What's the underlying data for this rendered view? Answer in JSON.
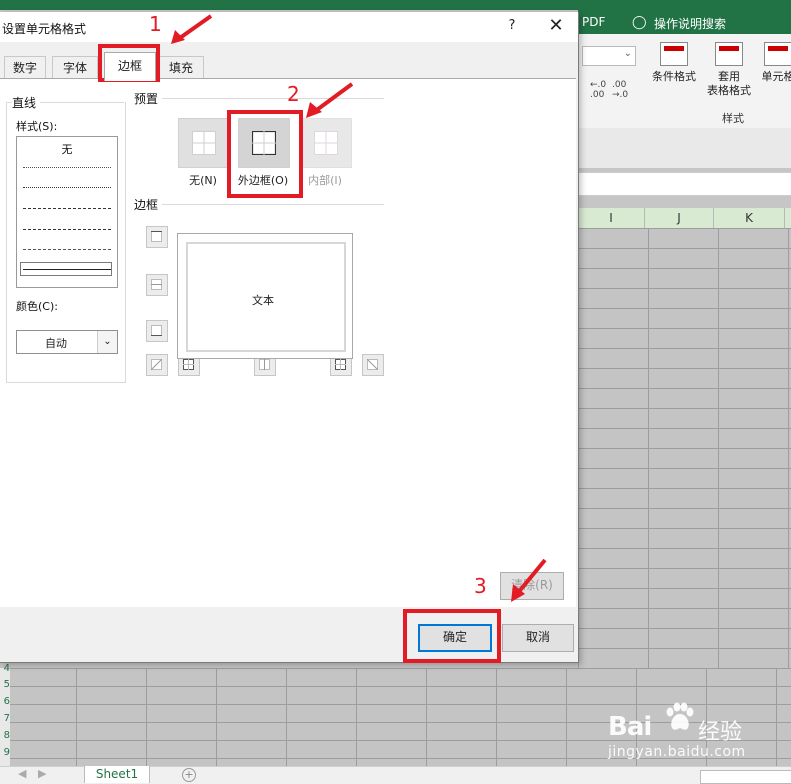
{
  "excel": {
    "ribbon_pdf": "PDF",
    "ribbon_search": "操作说明搜索",
    "conditional_format": "条件格式",
    "table_format_line1": "套用",
    "table_format_line2": "表格格式",
    "cell_styles": "单元格",
    "styles_group": "样式",
    "columns": [
      "I",
      "J",
      "K"
    ],
    "row_numbers": [
      "4",
      "5",
      "6",
      "7",
      "8",
      "9"
    ],
    "sheet_tab": "Sheet1",
    "add_sheet": "+"
  },
  "dialog": {
    "title": "设置单元格格式",
    "help": "?",
    "close": "✕",
    "tabs": [
      {
        "label": "数字",
        "active": false
      },
      {
        "label": "字体",
        "active": false
      },
      {
        "label": "边框",
        "active": true
      },
      {
        "label": "填充",
        "active": false
      }
    ],
    "line_group": {
      "title": "直线",
      "style_label": "样式(S):",
      "style_none": "无",
      "color_label": "颜色(C):",
      "color_value": "自动"
    },
    "presets": {
      "title": "预置",
      "items": [
        {
          "label": "无(N)",
          "enabled": true
        },
        {
          "label": "外边框(O)",
          "enabled": true
        },
        {
          "label": "内部(I)",
          "enabled": false
        }
      ]
    },
    "border": {
      "title": "边框",
      "preview_text": "文本"
    },
    "clear_button": "清除(R)",
    "ok_button": "确定",
    "cancel_button": "取消"
  },
  "annotations": {
    "step1": "1",
    "step2": "2",
    "step3": "3",
    "color": "#e21b25"
  },
  "watermark": {
    "logo": "Bai",
    "logo_cn": "经验",
    "url": "jingyan.baidu.com"
  }
}
